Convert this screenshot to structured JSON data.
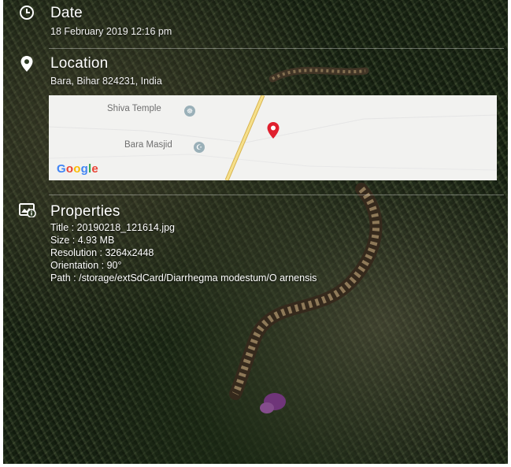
{
  "date": {
    "heading": "Date",
    "value": "18 February 2019 12:16 pm",
    "icon": "clock-icon"
  },
  "location": {
    "heading": "Location",
    "address": "Bara, Bihar 824231, India",
    "icon": "location-pin-icon",
    "map": {
      "poi_1": "Shiva Temple",
      "poi_2": "Bara Masjid",
      "brand": "Google",
      "pin_color": "#e0202e",
      "road_color": "#f3d36b"
    }
  },
  "properties": {
    "heading": "Properties",
    "icon": "image-info-icon",
    "lines": [
      "Title : 20190218_121614.jpg",
      "Size : 4.93 MB",
      "Resolution : 3264x2448",
      "Orientation : 90°",
      "Path : /storage/extSdCard/Diarrhegma modestum/O arnensis"
    ]
  }
}
